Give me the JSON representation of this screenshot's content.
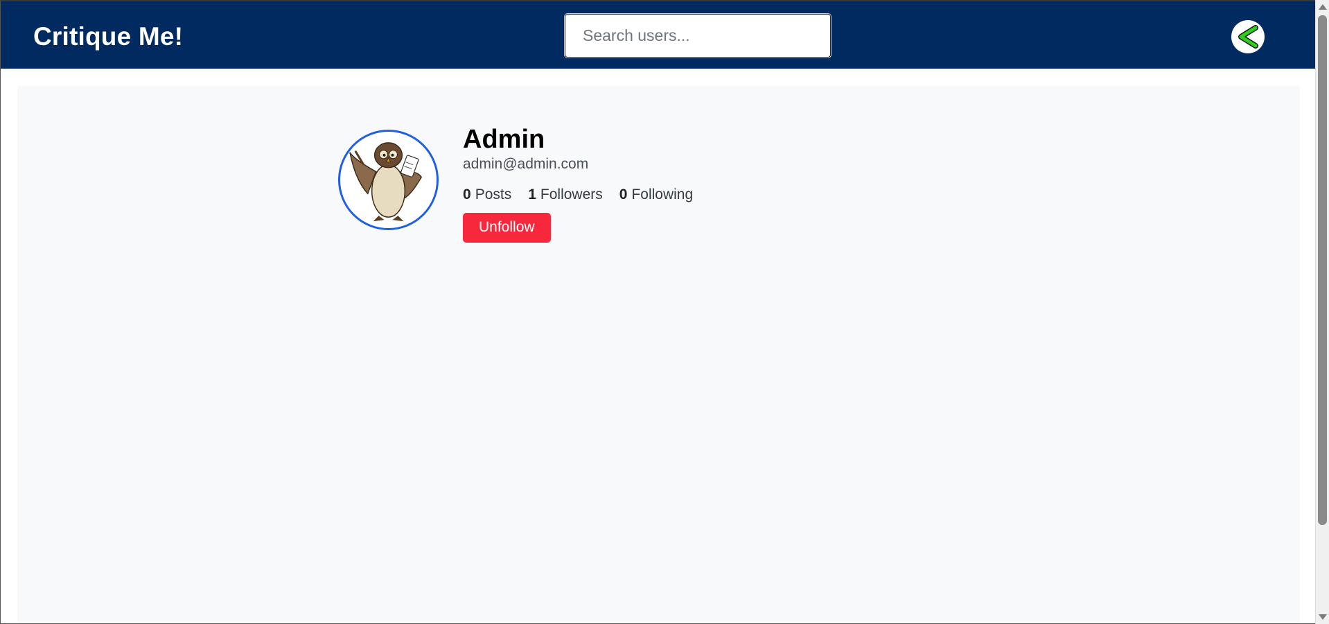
{
  "app": {
    "brand": "Critique Me!"
  },
  "search": {
    "placeholder": "Search users...",
    "value": ""
  },
  "nav": {
    "back_icon": "back-arrow-icon"
  },
  "profile": {
    "name": "Admin",
    "email": "admin@admin.com",
    "avatar_icon": "owl-avatar",
    "stats": {
      "posts_count": "0",
      "posts_label": "Posts",
      "followers_count": "1",
      "followers_label": "Followers",
      "following_count": "0",
      "following_label": "Following"
    },
    "action_label": "Unfollow"
  },
  "colors": {
    "navbar": "#002a60",
    "content_bg": "#f8f9fa",
    "unfollow_button": "#f7283b",
    "avatar_border": "#1f5fe0",
    "back_arrow": "#2bd01b"
  }
}
